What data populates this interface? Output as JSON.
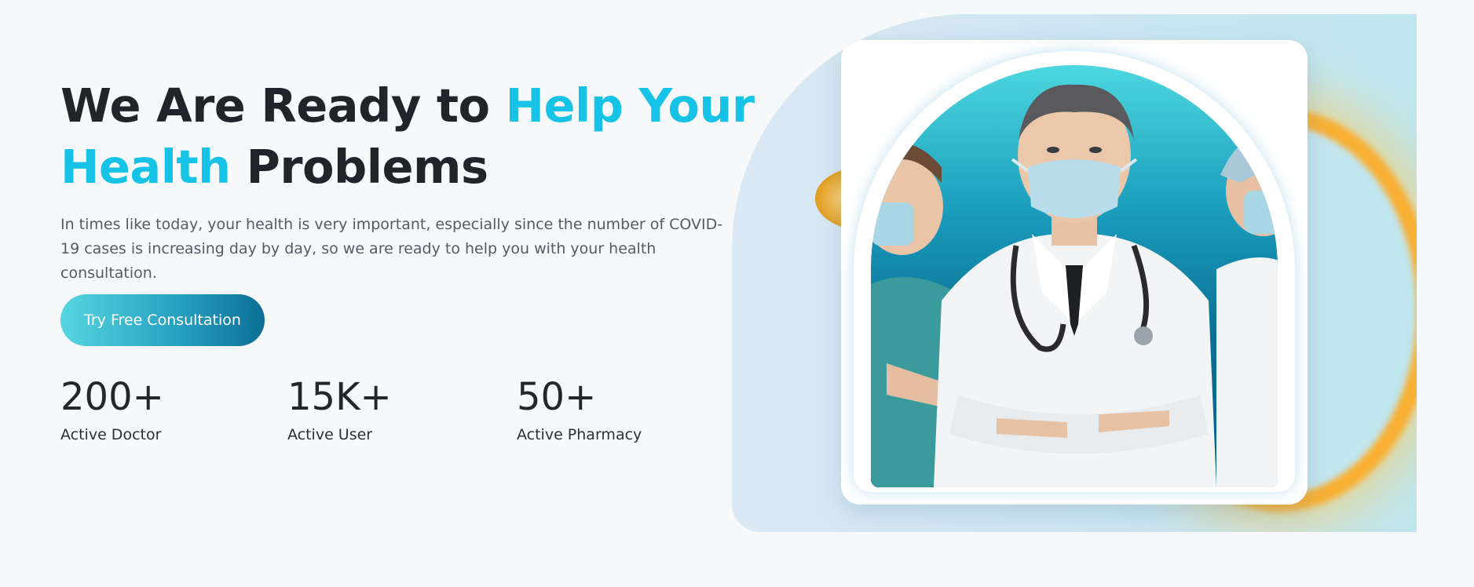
{
  "hero": {
    "title_part1": "We Are Ready to ",
    "title_accent1": "Help Your",
    "title_accent2": "Health",
    "title_part2": " Problems",
    "description": "In times like today, your health is very important, especially since the number of COVID-19 cases is increasing day by day, so we are ready to help you with your health consultation.",
    "cta_label": "Try Free Consultation"
  },
  "stats": [
    {
      "value": "200+",
      "label": "Active Doctor"
    },
    {
      "value": "15K+",
      "label": "Active User"
    },
    {
      "value": "50+",
      "label": "Active Pharmacy"
    }
  ],
  "colors": {
    "accent": "#16c3e6",
    "heading": "#22242a",
    "cta_gradient_start": "#55d6e0",
    "cta_gradient_end": "#0c6f95",
    "background": "#f6f8fa"
  },
  "image": {
    "subject": "doctors-with-masks-photo"
  }
}
